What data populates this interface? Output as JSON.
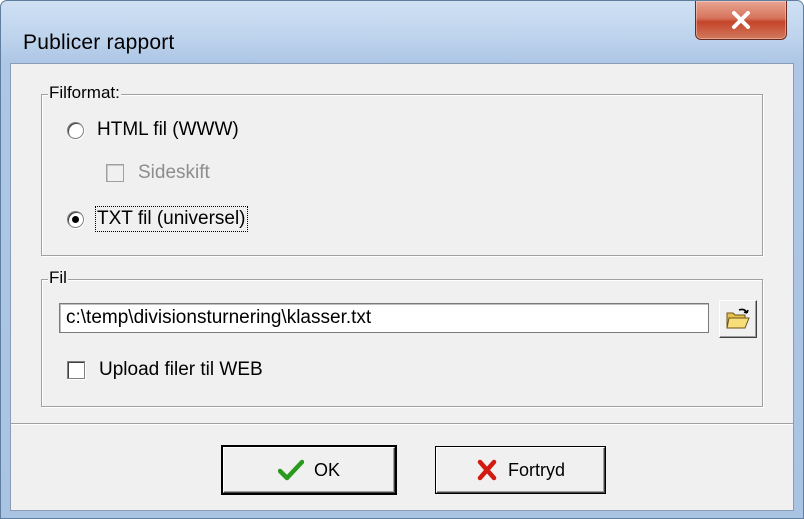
{
  "window": {
    "title": "Publicer rapport",
    "close_label": "X"
  },
  "filformat": {
    "caption": "Filformat:",
    "html_label": "HTML fil (WWW)",
    "html_selected": false,
    "sideskift_label": "Sideskift",
    "sideskift_enabled": false,
    "txt_label": "TXT fil (universel)",
    "txt_selected": true
  },
  "fil": {
    "caption": "Fil",
    "path_value": "c:\\temp\\divisionsturnering\\klasser.txt",
    "browse_icon": "open-folder-icon",
    "upload_label": "Upload filer til WEB",
    "upload_checked": false
  },
  "buttons": {
    "ok_label": "OK",
    "ok_icon": "checkmark-icon",
    "cancel_label": "Fortryd",
    "cancel_icon": "red-x-icon"
  },
  "colors": {
    "ok_check": "#2a9a1e",
    "cancel_x": "#d21a10",
    "close_button": "#c4452a"
  }
}
